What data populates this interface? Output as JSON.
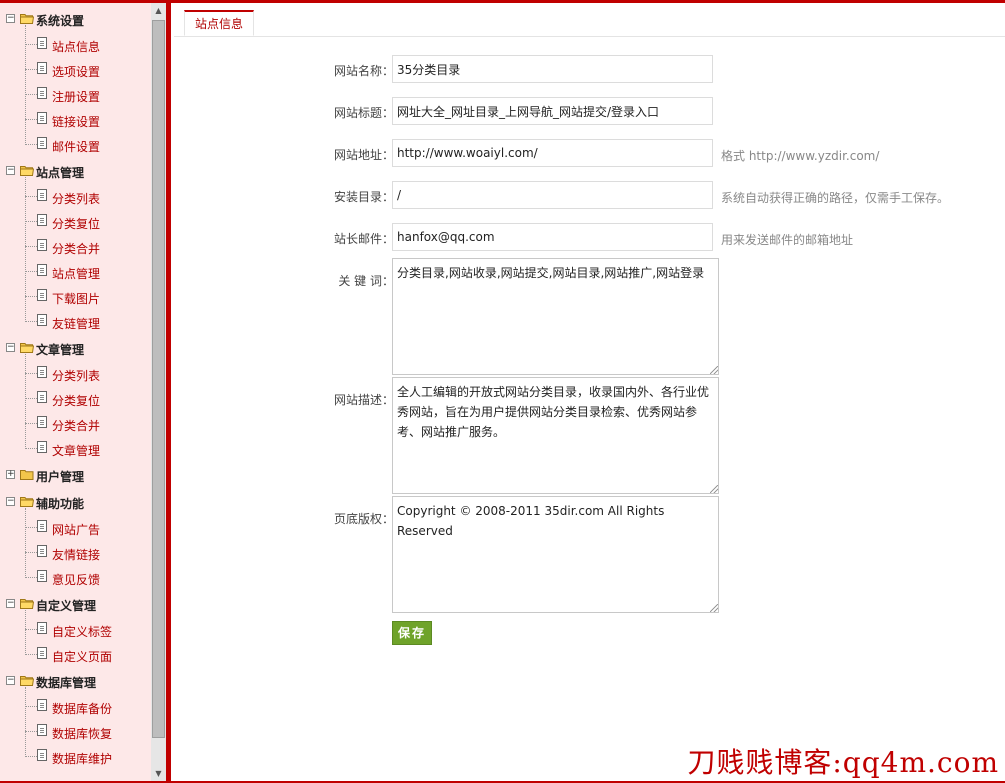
{
  "sidebar": {
    "groups": [
      {
        "label": "系统设置",
        "items": [
          "站点信息",
          "选项设置",
          "注册设置",
          "链接设置",
          "邮件设置"
        ]
      },
      {
        "label": "站点管理",
        "items": [
          "分类列表",
          "分类复位",
          "分类合并",
          "站点管理",
          "下载图片",
          "友链管理"
        ]
      },
      {
        "label": "文章管理",
        "items": [
          "分类列表",
          "分类复位",
          "分类合并",
          "文章管理"
        ]
      },
      {
        "label": "用户管理",
        "items": []
      },
      {
        "label": "辅助功能",
        "items": [
          "网站广告",
          "友情链接",
          "意见反馈"
        ]
      },
      {
        "label": "自定义管理",
        "items": [
          "自定义标签",
          "自定义页面"
        ]
      },
      {
        "label": "数据库管理",
        "items": [
          "数据库备份",
          "数据库恢复",
          "数据库维护"
        ]
      }
    ]
  },
  "tabs": {
    "active": "站点信息"
  },
  "form": {
    "site_name": {
      "label": "网站名称：",
      "value": "35分类目录"
    },
    "site_title": {
      "label": "网站标题：",
      "value": "网址大全_网址目录_上网导航_网站提交/登录入口"
    },
    "site_url": {
      "label": "网站地址：",
      "value": "http://www.woaiyl.com/",
      "hint": "格式 http://www.yzdir.com/"
    },
    "install_dir": {
      "label": "安装目录：",
      "value": "/",
      "hint": "系统自动获得正确的路径，仅需手工保存。"
    },
    "admin_email": {
      "label": "站长邮件：",
      "value": "hanfox@qq.com",
      "hint": "用来发送邮件的邮箱地址"
    },
    "keywords": {
      "label": "关 键 词：",
      "value": "分类目录,网站收录,网站提交,网站目录,网站推广,网站登录"
    },
    "description": {
      "label": "网站描述：",
      "value": "全人工编辑的开放式网站分类目录，收录国内外、各行业优秀网站，旨在为用户提供网站分类目录检索、优秀网站参考、网站推广服务。"
    },
    "copyright": {
      "label": "页底版权：",
      "value": "Copyright © 2008-2011 35dir.com All Rights Reserved"
    },
    "save_label": "保存"
  },
  "watermark": "刀贱贱博客:qq4m.com"
}
